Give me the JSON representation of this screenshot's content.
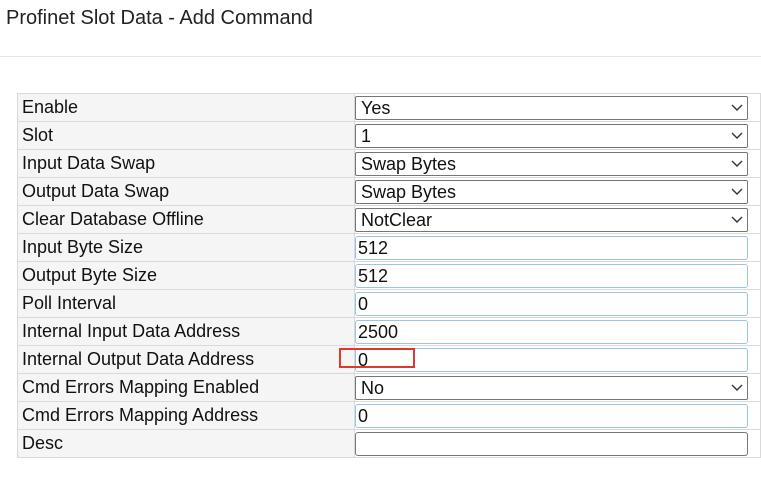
{
  "page": {
    "title": "Profinet Slot Data - Add Command"
  },
  "rows": [
    {
      "label": "Enable",
      "kind": "select",
      "value": "Yes"
    },
    {
      "label": "Slot",
      "kind": "select",
      "value": "1"
    },
    {
      "label": "Input Data Swap",
      "kind": "select",
      "value": "Swap Bytes"
    },
    {
      "label": "Output Data Swap",
      "kind": "select",
      "value": "Swap Bytes"
    },
    {
      "label": "Clear Database Offline",
      "kind": "select",
      "value": "NotClear"
    },
    {
      "label": "Input Byte Size",
      "kind": "input",
      "value": "512"
    },
    {
      "label": "Output Byte Size",
      "kind": "input",
      "value": "512"
    },
    {
      "label": "Poll Interval",
      "kind": "input",
      "value": "0"
    },
    {
      "label": "Internal Input Data Address",
      "kind": "input",
      "value": "2500"
    },
    {
      "label": "Internal Output Data Address",
      "kind": "input",
      "value": "0",
      "highlighted": true
    },
    {
      "label": "Cmd Errors Mapping Enabled",
      "kind": "select",
      "value": "No"
    },
    {
      "label": "Cmd Errors Mapping Address",
      "kind": "input",
      "value": "0"
    },
    {
      "label": "Desc",
      "kind": "input",
      "value": ""
    }
  ],
  "colors": {
    "highlight": "#e0392b",
    "label_bg": "#f5f5f5",
    "input_border": "#9ec1e6",
    "select_border": "#767676"
  },
  "icons": {
    "dropdown": "chevron-down-icon"
  }
}
